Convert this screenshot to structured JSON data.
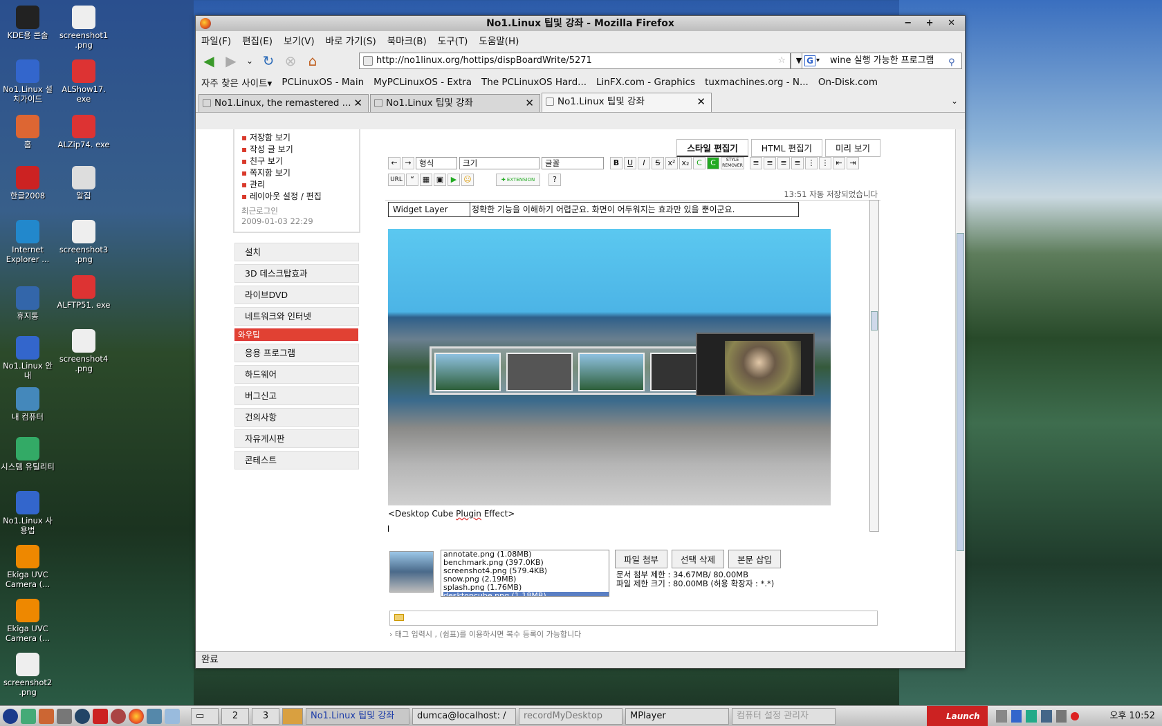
{
  "desktop": {
    "icons_left": [
      {
        "label": "KDE용 콘솔",
        "icon": "console-icon"
      },
      {
        "label": "No1.Linux 설치가이드",
        "icon": "install-guide-icon"
      },
      {
        "label": "홈",
        "icon": "home-icon"
      },
      {
        "label": "한글2008",
        "icon": "hangul-icon"
      },
      {
        "label": "Internet Explorer ...",
        "icon": "internet-explorer-icon"
      },
      {
        "label": "휴지통",
        "icon": "trash-icon"
      },
      {
        "label": "No1.Linux 안내",
        "icon": "info-icon"
      },
      {
        "label": "내 컴퓨터",
        "icon": "computer-icon"
      },
      {
        "label": "시스템 유틸리티",
        "icon": "system-utility-icon"
      },
      {
        "label": "No1.Linux 사용법",
        "icon": "usage-icon"
      },
      {
        "label": "Ekiga UVC Camera (...",
        "icon": "ekiga-icon"
      },
      {
        "label": "Ekiga UVC Camera (...",
        "icon": "ekiga-icon"
      },
      {
        "label": "screenshot2 .png",
        "icon": "image-file-icon"
      }
    ],
    "icons_right": [
      {
        "label": "screenshot1 .png",
        "icon": "image-file-icon"
      },
      {
        "label": "ALShow17. exe",
        "icon": "exe-icon"
      },
      {
        "label": "ALZip74. exe",
        "icon": "exe-icon"
      },
      {
        "label": "알집",
        "icon": "alzip-icon"
      },
      {
        "label": "screenshot3 .png",
        "icon": "image-file-icon"
      },
      {
        "label": "ALFTP51. exe",
        "icon": "exe-icon"
      },
      {
        "label": "screenshot4 .png",
        "icon": "image-file-icon"
      }
    ]
  },
  "window": {
    "title": "No1.Linux 팁및 강좌 - Mozilla Firefox",
    "controls": "− + ✕"
  },
  "menu": [
    "파일(F)",
    "편집(E)",
    "보기(V)",
    "바로 가기(S)",
    "북마크(B)",
    "도구(T)",
    "도움말(H)"
  ],
  "nav": {
    "url": "http://no1linux.org/hottips/dispBoardWrite/5271",
    "search_value": "wine 실행 가능한 프로그램"
  },
  "bookmarks": [
    "자주 찾은 사이트▾",
    "PCLinuxOS - Main",
    "MyPCLinuxOS - Extra",
    "The PCLinuxOS Hard...",
    "LinFX.com - Graphics",
    "tuxmachines.org - N...",
    "On-Disk.com"
  ],
  "tabs": [
    {
      "label": "No1.Linux, the remastered ..."
    },
    {
      "label": "No1.Linux 팁및 강좌"
    },
    {
      "label": "No1.Linux 팁및 강좌"
    }
  ],
  "sidebar": {
    "links": [
      "저장함 보기",
      "작성 글 보기",
      "친구 보기",
      "쪽지함 보기",
      "관리",
      "레이아웃 설정 / 편집"
    ],
    "recent_label": "최근로그인",
    "recent_date": "2009-01-03 22:29",
    "categories": [
      "설치",
      "3D 데스크탑효과",
      "라이브DVD",
      "네트워크와 인터넷",
      "와우팁",
      "응용 프로그램",
      "하드웨어",
      "버그신고",
      "건의사항",
      "자유게시판",
      "콘테스트"
    ],
    "selected_index": 4
  },
  "editor": {
    "tabs": [
      "스타일 편집기",
      "HTML 편집기",
      "미리 보기"
    ],
    "format_select": "형식",
    "size_select": "크기",
    "font_select": "글꼴",
    "url_btn": "URL",
    "autosave": "13:51  자동 저장되었습니다",
    "widget_label": "Widget Layer",
    "widget_text": "정확한 기능을 이해하기 어렵군요. 화면이 어두워지는 효과만 있을 뿐이군요.",
    "caption_prefix": "<Desktop Cube ",
    "caption_word": "Plugin",
    "caption_suffix": " Effect>"
  },
  "attachments": {
    "files": [
      "annotate.png  (1.08MB)",
      "benchmark.png  (397.0KB)",
      "screenshot4.png  (579.4KB)",
      "snow.png  (2.19MB)",
      "splash.png  (1.76MB)",
      "desktopcube.png  (1.18MB)"
    ],
    "selected_index": 5,
    "buttons": [
      "파일 첨부",
      "선택 삭제",
      "본문 삽입"
    ],
    "limit_doc": "문서 첨부 제한 : 34.67MB/ 80.00MB",
    "limit_file": "파일 제한 크기 : 80.00MB (허용 확장자 : *.*)",
    "tag_hint": "› 태그 입력시 , (쉼표)를 이용하시면 복수 등록이 가능합니다"
  },
  "status": "완료",
  "taskbar": {
    "desktops": [
      "2",
      "3"
    ],
    "tasks": [
      "No1.Linux 팁및 강좌",
      "dumca@localhost: /",
      "recordMyDesktop",
      "MPlayer",
      "컴퓨터 설정 관리자"
    ],
    "launch": "Launch",
    "clock": "오후 10:52"
  }
}
